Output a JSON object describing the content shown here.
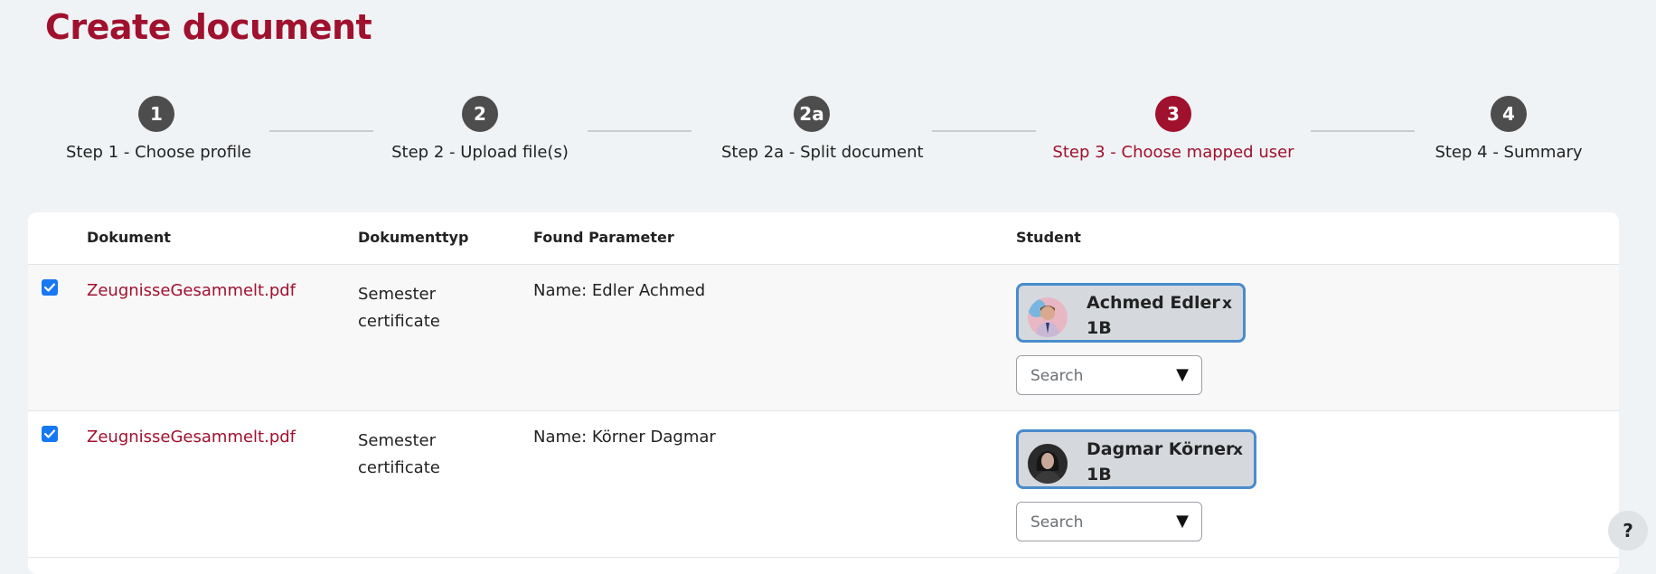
{
  "page": {
    "title": "Create document"
  },
  "steps": [
    {
      "num": "1",
      "label": "Step 1 - Choose profile"
    },
    {
      "num": "2",
      "label": "Step 2 - Upload file(s)"
    },
    {
      "num": "2a",
      "label": "Step 2a - Split document"
    },
    {
      "num": "3",
      "label": "Step 3 - Choose mapped user"
    },
    {
      "num": "4",
      "label": "Step 4 - Summary"
    }
  ],
  "active_step": 3,
  "table": {
    "headers": {
      "document": "Dokument",
      "doctype": "Dokumenttyp",
      "param": "Found Parameter",
      "student": "Student"
    },
    "rows": [
      {
        "checked": true,
        "document": "ZeugnisseGesammelt.pdf",
        "doctype_line1": "Semester",
        "doctype_line2": "certificate",
        "param": "Name: Edler Achmed",
        "student_name": "Achmed Edler",
        "student_class": "1B",
        "remove": "x",
        "search_placeholder": "Search",
        "caret": "▼"
      },
      {
        "checked": true,
        "document": "ZeugnisseGesammelt.pdf",
        "doctype_line1": "Semester",
        "doctype_line2": "certificate",
        "param": "Name: Körner Dagmar",
        "student_name": "Dagmar Körner",
        "student_class": "1B",
        "remove": "x",
        "search_placeholder": "Search",
        "caret": "▼"
      }
    ]
  },
  "help": {
    "label": "?"
  },
  "colors": {
    "brand": "#a0112e",
    "step_inactive": "#4d4d4d",
    "chip_border": "#4a8ccc",
    "checkbox": "#1877f2"
  }
}
